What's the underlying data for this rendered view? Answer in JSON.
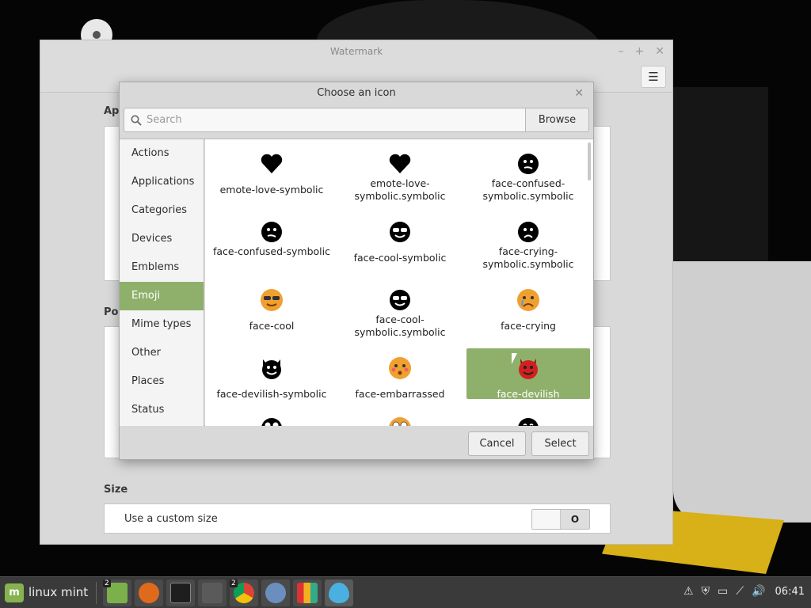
{
  "main_window": {
    "title": "Watermark",
    "section_app": "Ap",
    "section_pos": "Pos",
    "section_size": "Size",
    "custom_size_label": "Use a custom size",
    "toggle_state": "O"
  },
  "dialog": {
    "title": "Choose an icon",
    "search_placeholder": "Search",
    "browse_label": "Browse",
    "categories": [
      "Actions",
      "Applications",
      "Categories",
      "Devices",
      "Emblems",
      "Emoji",
      "Mime types",
      "Other",
      "Places",
      "Status"
    ],
    "active_category": "Emoji",
    "icons": [
      {
        "label": "emote-love-symbolic",
        "icon": "heart-icon"
      },
      {
        "label": "emote-love-symbolic.symbolic",
        "icon": "heart-icon"
      },
      {
        "label": "face-confused-symbolic.symbolic",
        "icon": "face-confused-icon"
      },
      {
        "label": "face-confused-symbolic",
        "icon": "face-confused-icon"
      },
      {
        "label": "face-cool-symbolic",
        "icon": "face-cool-icon"
      },
      {
        "label": "face-crying-symbolic.symbolic",
        "icon": "face-crying-icon"
      },
      {
        "label": "face-cool",
        "icon": "face-cool-color-icon"
      },
      {
        "label": "face-cool-symbolic.symbolic",
        "icon": "face-cool-icon"
      },
      {
        "label": "face-crying",
        "icon": "face-crying-color-icon"
      },
      {
        "label": "face-devilish-symbolic",
        "icon": "face-devilish-icon"
      },
      {
        "label": "face-embarrassed",
        "icon": "face-embarrassed-color-icon"
      },
      {
        "label": "face-devilish",
        "icon": "face-devilish-color-icon"
      }
    ],
    "selected_icon": "face-devilish",
    "cancel_label": "Cancel",
    "select_label": "Select"
  },
  "taskbar": {
    "menu_label": "linux mint",
    "files_badge": "2",
    "chrome_badge": "2",
    "clock": "06:41"
  },
  "colors": {
    "accent": "#8fb06b",
    "taskbar": "#3a3a3a"
  }
}
